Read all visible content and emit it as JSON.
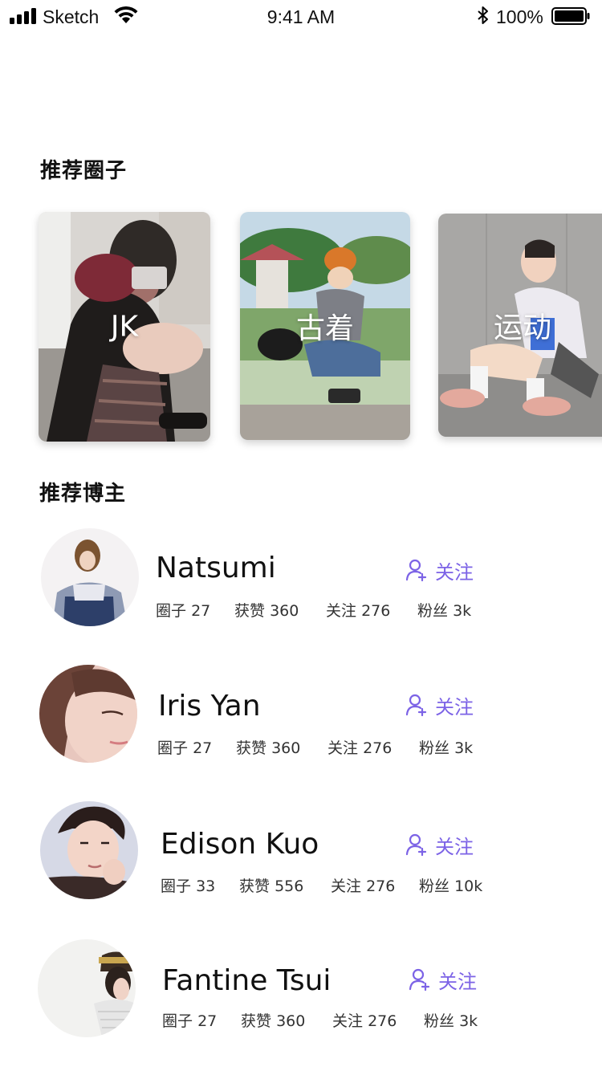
{
  "status_bar": {
    "carrier": "Sketch",
    "time": "9:41 AM",
    "battery": "100%"
  },
  "sections": {
    "circles_title": "推荐圈子",
    "bloggers_title": "推荐博主"
  },
  "circles": [
    {
      "label": "JK"
    },
    {
      "label": "古着"
    },
    {
      "label": "运动"
    }
  ],
  "bloggers": [
    {
      "name": "Natsumi",
      "follow_label": "关注",
      "stats": [
        {
          "label": "圈子",
          "value": "27"
        },
        {
          "label": "获赞",
          "value": "360"
        },
        {
          "label": "关注",
          "value": "276"
        },
        {
          "label": "粉丝",
          "value": "3k"
        }
      ]
    },
    {
      "name": "Iris Yan",
      "follow_label": "关注",
      "stats": [
        {
          "label": "圈子",
          "value": "27"
        },
        {
          "label": "获赞",
          "value": "360"
        },
        {
          "label": "关注",
          "value": "276"
        },
        {
          "label": "粉丝",
          "value": "3k"
        }
      ]
    },
    {
      "name": "Edison Kuo",
      "follow_label": "关注",
      "stats": [
        {
          "label": "圈子",
          "value": "33"
        },
        {
          "label": "获赞",
          "value": "556"
        },
        {
          "label": "关注",
          "value": "276"
        },
        {
          "label": "粉丝",
          "value": "10k"
        }
      ]
    },
    {
      "name": "Fantine Tsui",
      "follow_label": "关注",
      "stats": [
        {
          "label": "圈子",
          "value": "27"
        },
        {
          "label": "获赞",
          "value": "360"
        },
        {
          "label": "关注",
          "value": "276"
        },
        {
          "label": "粉丝",
          "value": "3k"
        }
      ]
    }
  ],
  "colors": {
    "accent": "#7c63e6",
    "text_primary": "#111111",
    "text_secondary": "#333333"
  },
  "icons": {
    "signal": "cellular-signal-icon",
    "wifi": "wifi-icon",
    "bluetooth": "bluetooth-icon",
    "battery": "battery-icon",
    "follow": "add-user-icon"
  }
}
